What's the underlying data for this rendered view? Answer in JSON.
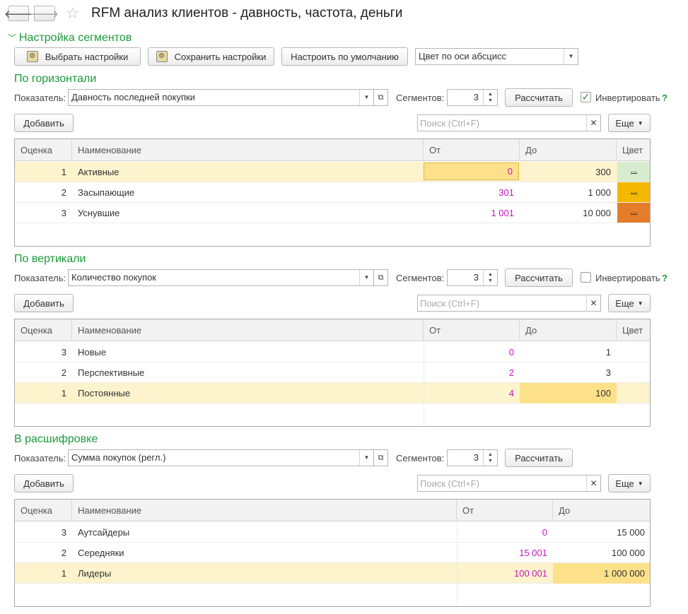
{
  "window": {
    "title": "RFM анализ клиентов - давность, частота, деньги",
    "back_icon": "arrow-left-icon",
    "forward_icon": "arrow-right-icon",
    "favorite_icon": "star-icon"
  },
  "settings": {
    "group_title": "Настройка сегментов",
    "choose_label": "Выбрать настройки",
    "save_label": "Сохранить настройки",
    "default_label": "Настроить по умолчанию",
    "color_axis_value": "Цвет по оси абсцисс"
  },
  "horizontal": {
    "title": "По горизонтали",
    "indicator_label": "Показатель:",
    "indicator_value": "Давность последней покупки",
    "segments_label": "Сегментов:",
    "segments_value": "3",
    "calc_label": "Рассчитать",
    "invert_label": "Инвертировать",
    "invert_checked": true,
    "add_label": "Добавить",
    "search_placeholder": "Поиск (Ctrl+F)",
    "more_label": "Еще",
    "columns": [
      "Оценка",
      "Наименование",
      "От",
      "До",
      "Цвет"
    ],
    "rows": [
      {
        "score": "1",
        "name": "Активные",
        "from": "0",
        "to": "300",
        "color": "...",
        "color_hex": "#d7ebcf"
      },
      {
        "score": "2",
        "name": "Засыпающие",
        "from": "301",
        "to": "1 000",
        "color": "...",
        "color_hex": "#f5b800"
      },
      {
        "score": "3",
        "name": "Уснувшие",
        "from": "1 001",
        "to": "10 000",
        "color": "...",
        "color_hex": "#e57c2a"
      }
    ]
  },
  "vertical": {
    "title": "По вертикали",
    "indicator_label": "Показатель:",
    "indicator_value": "Количество покупок",
    "segments_label": "Сегментов:",
    "segments_value": "3",
    "calc_label": "Рассчитать",
    "invert_label": "Инвертировать",
    "invert_checked": false,
    "add_label": "Добавить",
    "search_placeholder": "Поиск (Ctrl+F)",
    "more_label": "Еще",
    "columns": [
      "Оценка",
      "Наименование",
      "От",
      "До",
      "Цвет"
    ],
    "rows": [
      {
        "score": "3",
        "name": "Новые",
        "from": "0",
        "to": "1"
      },
      {
        "score": "2",
        "name": "Перспективные",
        "from": "2",
        "to": "3"
      },
      {
        "score": "1",
        "name": "Постоянные",
        "from": "4",
        "to": "100"
      }
    ]
  },
  "detail": {
    "title": "В расшифровке",
    "indicator_label": "Показатель:",
    "indicator_value": "Сумма покупок (регл.)",
    "segments_label": "Сегментов:",
    "segments_value": "3",
    "calc_label": "Рассчитать",
    "add_label": "Добавить",
    "search_placeholder": "Поиск (Ctrl+F)",
    "more_label": "Еще",
    "columns": [
      "Оценка",
      "Наименование",
      "От",
      "До"
    ],
    "rows": [
      {
        "score": "3",
        "name": "Аутсайдеры",
        "from": "0",
        "to": "15 000"
      },
      {
        "score": "2",
        "name": "Середняки",
        "from": "15 001",
        "to": "100 000"
      },
      {
        "score": "1",
        "name": "Лидеры",
        "from": "100 001",
        "to": "1 000 000"
      }
    ]
  },
  "colors": {
    "accent_green": "#1a9a3a",
    "selected_row": "#fdf3cc",
    "focus_cell": "#fce18a",
    "numeric_from": "#c515c5"
  }
}
